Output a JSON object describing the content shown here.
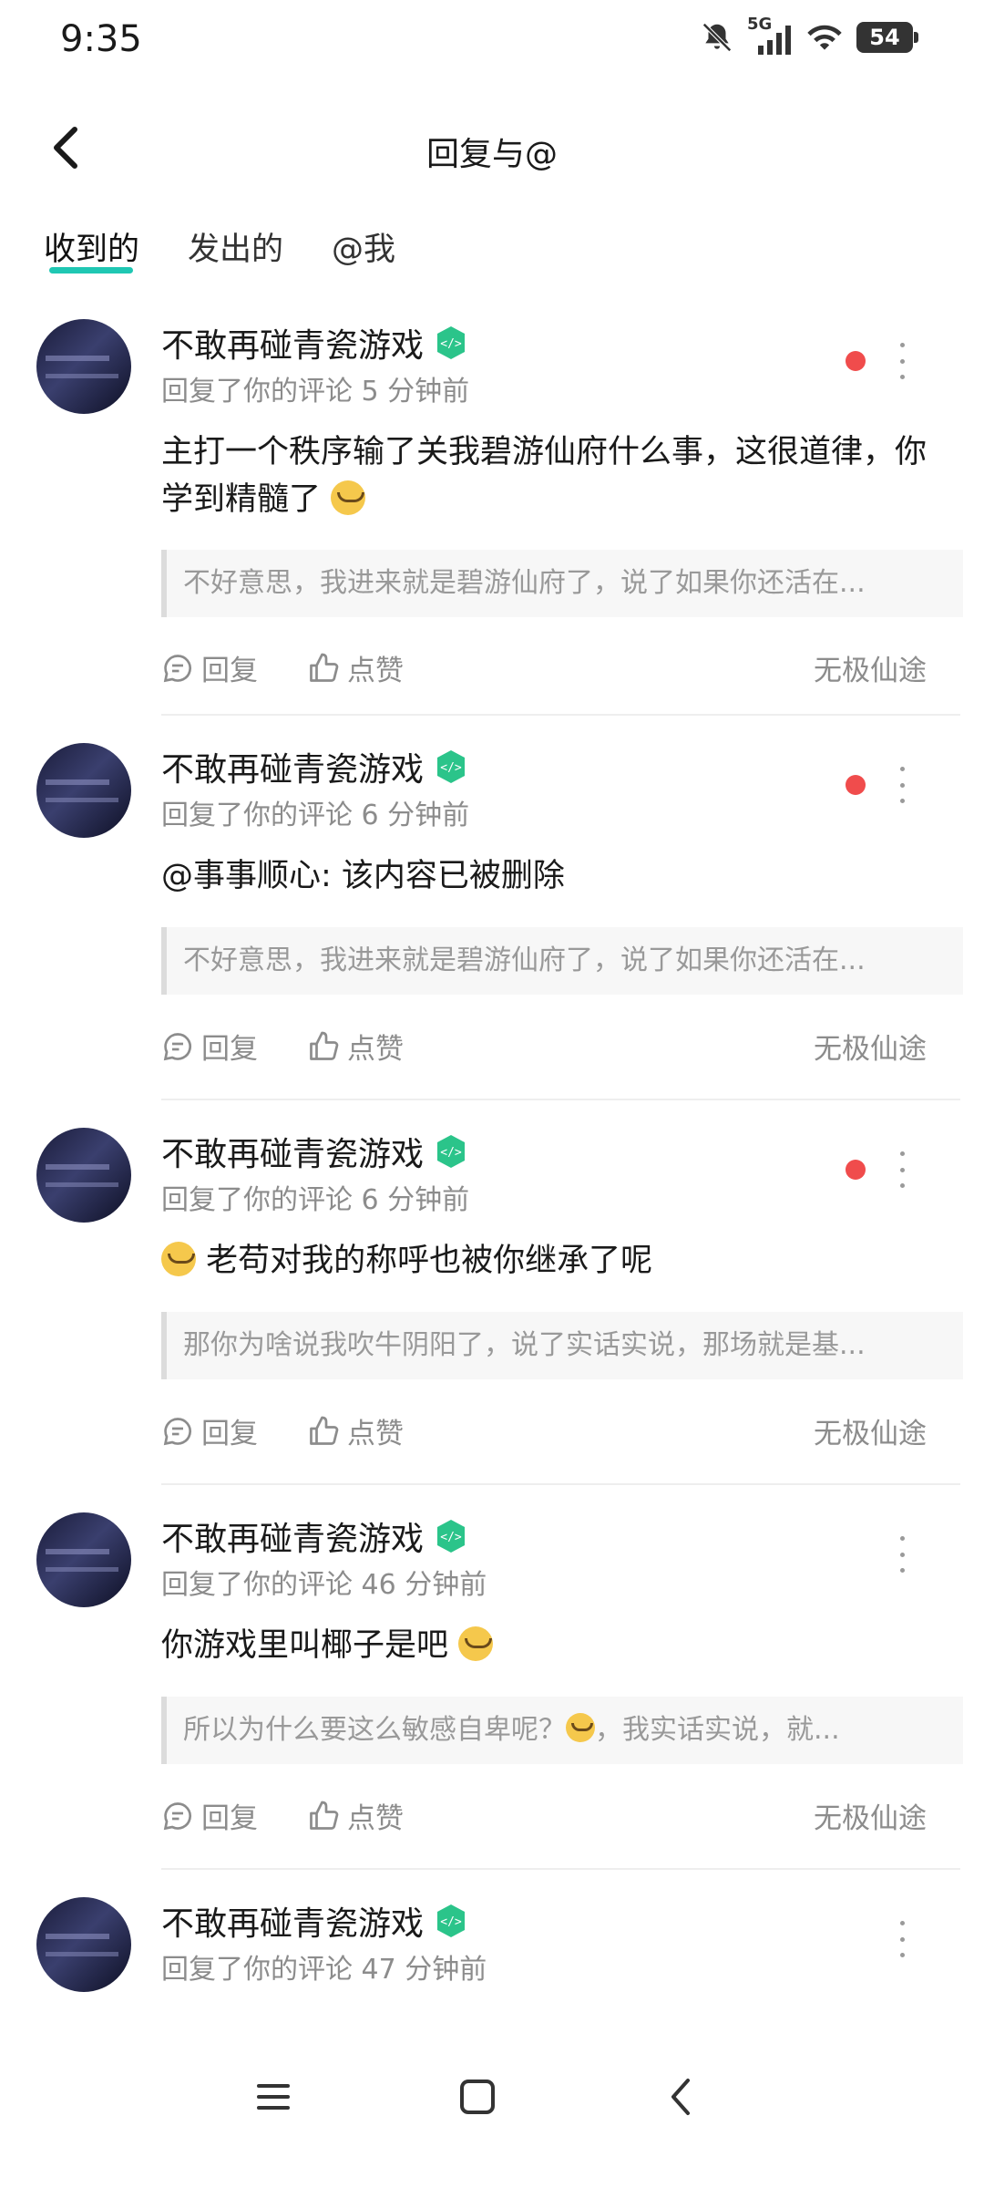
{
  "status": {
    "time": "9:35",
    "network": "5G",
    "battery": "54"
  },
  "header": {
    "title": "回复与@"
  },
  "tabs": [
    {
      "label": "收到的",
      "active": true
    },
    {
      "label": "发出的",
      "active": false
    },
    {
      "label": "@我",
      "active": false
    }
  ],
  "accent_color": "#1fc7b3",
  "items": [
    {
      "username": "不敢再碰青瓷游戏",
      "meta": "回复了你的评论 5 分钟前",
      "content": "主打一个秩序输了关我碧游仙府什么事，这很道律，你学到精髓了",
      "quote": "不好意思，我进来就是碧游仙府了，说了如果你还活在...",
      "reply_label": "回复",
      "like_label": "点赞",
      "source": "无极仙途",
      "unread": true
    },
    {
      "username": "不敢再碰青瓷游戏",
      "meta": "回复了你的评论 6 分钟前",
      "content": "@事事顺心: 该内容已被删除",
      "quote": "不好意思，我进来就是碧游仙府了，说了如果你还活在...",
      "reply_label": "回复",
      "like_label": "点赞",
      "source": "无极仙途",
      "unread": true
    },
    {
      "username": "不敢再碰青瓷游戏",
      "meta": "回复了你的评论 6 分钟前",
      "content": "老苟对我的称呼也被你继承了呢",
      "quote": "那你为啥说我吹牛阴阳了，说了实话实说，那场就是基...",
      "reply_label": "回复",
      "like_label": "点赞",
      "source": "无极仙途",
      "unread": true
    },
    {
      "username": "不敢再碰青瓷游戏",
      "meta": "回复了你的评论 46 分钟前",
      "content": "你游戏里叫椰子是吧",
      "quote_a": "所以为什么要这么敏感自卑呢？",
      "quote_b": "，我实话实说，就...",
      "reply_label": "回复",
      "like_label": "点赞",
      "source": "无极仙途",
      "unread": false
    },
    {
      "username": "不敢再碰青瓷游戏",
      "meta": "回复了你的评论 47 分钟前",
      "unread": false
    }
  ]
}
